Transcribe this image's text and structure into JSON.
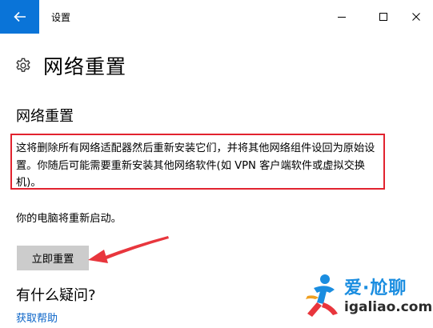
{
  "window": {
    "title": "设置"
  },
  "page": {
    "title": "网络重置",
    "section_title": "网络重置",
    "description": "这将删除所有网络适配器然后重新安装它们，并将其他网络组件设回为原始设置。你随后可能需要重新安装其他网络软件(如 VPN 客户端软件或虚拟交换机)。",
    "restart_note": "你的电脑将重新启动。",
    "reset_button": "立即重置",
    "question_heading": "有什么疑问?",
    "help_link": "获取帮助"
  },
  "watermark": {
    "name": "爱·尬聊",
    "url": "igaliao.com"
  },
  "icons": {
    "back": "back-arrow-icon",
    "minimize": "minimize-icon",
    "maximize": "maximize-icon",
    "close": "close-icon",
    "settings": "gear-icon"
  },
  "colors": {
    "accent": "#0a74d8",
    "highlight_border": "#e2232f",
    "annotation_arrow": "#e8363d",
    "button_bg": "#cccccc",
    "link": "#0a64c8"
  }
}
